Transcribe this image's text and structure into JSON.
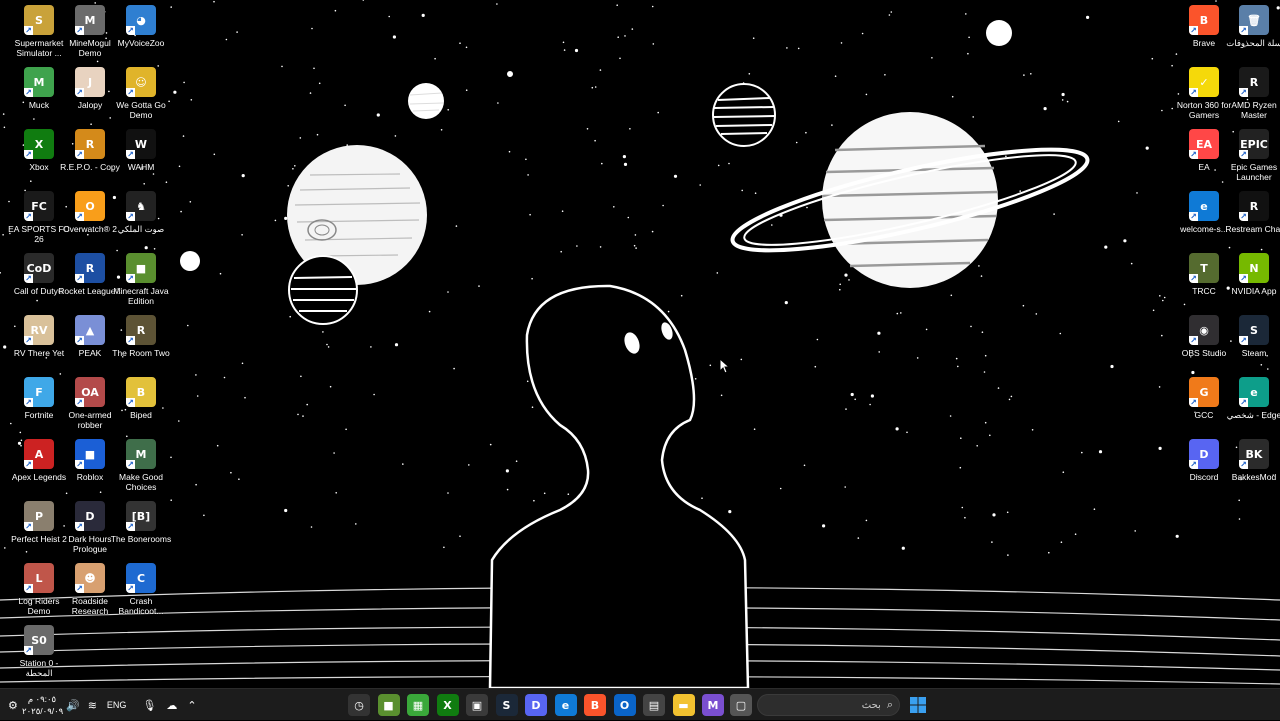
{
  "desktop": {
    "left_icons": [
      {
        "label": "Supermarket Simulator ...",
        "icon": "supermarket-icon",
        "color": "#c9a23a",
        "glyph": "S",
        "col": 0,
        "row": 0
      },
      {
        "label": "MineMogul Demo",
        "icon": "minemogul-icon",
        "color": "#6b6b6b",
        "glyph": "M",
        "col": 1,
        "row": 0
      },
      {
        "label": "MyVoiceZoo",
        "icon": "myvoicezoo-icon",
        "color": "#2f7fd1",
        "glyph": "◕",
        "col": 2,
        "row": 0
      },
      {
        "label": "Muck",
        "icon": "muck-icon",
        "color": "#3fa34d",
        "glyph": "M",
        "col": 0,
        "row": 1
      },
      {
        "label": "Jalopy",
        "icon": "jalopy-icon",
        "color": "#e8d3c0",
        "glyph": "J",
        "col": 1,
        "row": 1
      },
      {
        "label": "We Gotta Go Demo",
        "icon": "we-gotta-go-icon",
        "color": "#e0b42a",
        "glyph": "☺",
        "col": 2,
        "row": 1
      },
      {
        "label": "Xbox",
        "icon": "xbox-icon",
        "color": "#107c10",
        "glyph": "X",
        "col": 0,
        "row": 2
      },
      {
        "label": "R.E.P.O. - Copy",
        "icon": "repo-icon",
        "color": "#d48a1a",
        "glyph": "R",
        "col": 1,
        "row": 2
      },
      {
        "label": "WAHM",
        "icon": "wahm-icon",
        "color": "#111111",
        "glyph": "W",
        "col": 2,
        "row": 2
      },
      {
        "label": "EA SPORTS FC 26",
        "icon": "ea-fc-icon",
        "color": "#1a1a1a",
        "glyph": "FC",
        "col": 0,
        "row": 3
      },
      {
        "label": "Overwatch® 2",
        "icon": "overwatch-icon",
        "color": "#f99e1a",
        "glyph": "O",
        "col": 1,
        "row": 3
      },
      {
        "label": "صوت الملكي",
        "icon": "royal-voice-icon",
        "color": "#222222",
        "glyph": "♞",
        "col": 2,
        "row": 3
      },
      {
        "label": "Call of Duty®",
        "icon": "call-of-duty-icon",
        "color": "#2a2a2a",
        "glyph": "CoD",
        "col": 0,
        "row": 4
      },
      {
        "label": "Rocket League®",
        "icon": "rocket-league-icon",
        "color": "#1d4fa3",
        "glyph": "R",
        "col": 1,
        "row": 4
      },
      {
        "label": "Minecraft Java Edition",
        "icon": "minecraft-icon",
        "color": "#5a8f2f",
        "glyph": "■",
        "col": 2,
        "row": 4
      },
      {
        "label": "RV There Yet",
        "icon": "rv-there-yet-icon",
        "color": "#d9c19a",
        "glyph": "RV",
        "col": 0,
        "row": 5
      },
      {
        "label": "PEAK",
        "icon": "peak-icon",
        "color": "#7a8fd6",
        "glyph": "▲",
        "col": 1,
        "row": 5
      },
      {
        "label": "The Room Two",
        "icon": "the-room-two-icon",
        "color": "#5d5335",
        "glyph": "R",
        "col": 2,
        "row": 5
      },
      {
        "label": "Fortnite",
        "icon": "fortnite-icon",
        "color": "#3fa8e8",
        "glyph": "F",
        "col": 0,
        "row": 6
      },
      {
        "label": "One-armed robber",
        "icon": "one-armed-robber-icon",
        "color": "#b34a4a",
        "glyph": "OA",
        "col": 1,
        "row": 6
      },
      {
        "label": "Biped",
        "icon": "biped-icon",
        "color": "#e2c13a",
        "glyph": "B",
        "col": 2,
        "row": 6
      },
      {
        "label": "Apex Legends",
        "icon": "apex-legends-icon",
        "color": "#cc2222",
        "glyph": "A",
        "col": 0,
        "row": 7
      },
      {
        "label": "Roblox",
        "icon": "roblox-icon",
        "color": "#1b5fd6",
        "glyph": "■",
        "col": 1,
        "row": 7
      },
      {
        "label": "Make Good Choices",
        "icon": "make-good-choices-icon",
        "color": "#3f6e4a",
        "glyph": "M",
        "col": 2,
        "row": 7
      },
      {
        "label": "Perfect Heist 2",
        "icon": "perfect-heist-icon",
        "color": "#8a7f6e",
        "glyph": "P",
        "col": 0,
        "row": 8
      },
      {
        "label": "Dark Hours Prologue",
        "icon": "dark-hours-icon",
        "color": "#2a2a3a",
        "glyph": "D",
        "col": 1,
        "row": 8
      },
      {
        "label": "The Bonerooms",
        "icon": "bonerooms-icon",
        "color": "#333333",
        "glyph": "[B]",
        "col": 2,
        "row": 8
      },
      {
        "label": "Log Riders Demo",
        "icon": "log-riders-icon",
        "color": "#c0564a",
        "glyph": "L",
        "col": 0,
        "row": 9
      },
      {
        "label": "Roadside Research",
        "icon": "roadside-research-icon",
        "color": "#d8a070",
        "glyph": "☻",
        "col": 1,
        "row": 9
      },
      {
        "label": "Crash Bandicoot...",
        "icon": "crash-bandicoot-icon",
        "color": "#1e6ad1",
        "glyph": "C",
        "col": 2,
        "row": 9
      },
      {
        "label": "Station 0 - المحطة",
        "icon": "station-zero-icon",
        "color": "#6a6a6a",
        "glyph": "S0",
        "col": 0,
        "row": 10
      }
    ],
    "right_icons": [
      {
        "label": "Brave",
        "icon": "brave-icon",
        "color": "#fb542b",
        "glyph": "B",
        "col": 0,
        "row": 0
      },
      {
        "label": "سلة المحذوفات",
        "icon": "recycle-bin-icon",
        "color": "#5a7fa8",
        "glyph": "🗑",
        "col": 1,
        "row": 0
      },
      {
        "label": "Norton 360 for Gamers",
        "icon": "norton-icon",
        "color": "#f5d90a",
        "glyph": "✓",
        "col": 0,
        "row": 1
      },
      {
        "label": "AMD Ryzen Master",
        "icon": "amd-ryzen-icon",
        "color": "#1a1a1a",
        "glyph": "R",
        "col": 1,
        "row": 1
      },
      {
        "label": "EA",
        "icon": "ea-icon",
        "color": "#ff4747",
        "glyph": "EA",
        "col": 0,
        "row": 2
      },
      {
        "label": "Epic Games Launcher",
        "icon": "epic-games-icon",
        "color": "#222222",
        "glyph": "EPIC",
        "col": 1,
        "row": 2
      },
      {
        "label": "welcome-s...",
        "icon": "edge-doc-icon",
        "color": "#0f7ad6",
        "glyph": "e",
        "col": 0,
        "row": 3
      },
      {
        "label": "Restream Chat",
        "icon": "restream-icon",
        "color": "#111111",
        "glyph": "R",
        "col": 1,
        "row": 3
      },
      {
        "label": "TRCC",
        "icon": "trcc-icon",
        "color": "#556b2f",
        "glyph": "T",
        "col": 0,
        "row": 4
      },
      {
        "label": "NVIDIA App",
        "icon": "nvidia-icon",
        "color": "#76b900",
        "glyph": "N",
        "col": 1,
        "row": 4
      },
      {
        "label": "OBS Studio",
        "icon": "obs-icon",
        "color": "#302e31",
        "glyph": "◉",
        "col": 0,
        "row": 5
      },
      {
        "label": "Steam",
        "icon": "steam-icon",
        "color": "#1b2838",
        "glyph": "S",
        "col": 1,
        "row": 5
      },
      {
        "label": "GCC",
        "icon": "gcc-icon",
        "color": "#f07a1a",
        "glyph": "G",
        "col": 0,
        "row": 6
      },
      {
        "label": "شخصي - Edge",
        "icon": "edge-personal-icon",
        "color": "#0d9e8a",
        "glyph": "e",
        "col": 1,
        "row": 6
      },
      {
        "label": "Discord",
        "icon": "discord-icon",
        "color": "#5865f2",
        "glyph": "D",
        "col": 0,
        "row": 7
      },
      {
        "label": "BakkesMod",
        "icon": "bakkesmod-icon",
        "color": "#2b2b2b",
        "glyph": "BK",
        "col": 1,
        "row": 7
      }
    ]
  },
  "taskbar": {
    "clock_time": "٠٩:٠٥ م",
    "clock_date": "٢٠٢٥/٠٩/٠٩",
    "language": "ENG",
    "search_placeholder": "بحث",
    "apps": [
      {
        "name": "taskbar-clock-app-icon",
        "color": "#333333",
        "glyph": "◷"
      },
      {
        "name": "taskbar-minecraft-icon",
        "color": "#5a8f2f",
        "glyph": "■"
      },
      {
        "name": "taskbar-creeper-icon",
        "color": "#3aa83a",
        "glyph": "▦"
      },
      {
        "name": "taskbar-xbox-icon",
        "color": "#107c10",
        "glyph": "X"
      },
      {
        "name": "taskbar-app-icon",
        "color": "#3a3a3a",
        "glyph": "▣"
      },
      {
        "name": "taskbar-steam-icon",
        "color": "#1b2838",
        "glyph": "S"
      },
      {
        "name": "taskbar-discord-icon",
        "color": "#5865f2",
        "glyph": "D"
      },
      {
        "name": "taskbar-edge-icon",
        "color": "#0f7ad6",
        "glyph": "e"
      },
      {
        "name": "taskbar-brave-icon",
        "color": "#fb542b",
        "glyph": "B"
      },
      {
        "name": "taskbar-outlook-icon",
        "color": "#0a64c8",
        "glyph": "O"
      },
      {
        "name": "taskbar-store-icon",
        "color": "#444444",
        "glyph": "▤"
      },
      {
        "name": "taskbar-file-explorer-icon",
        "color": "#f2c230",
        "glyph": "▬"
      },
      {
        "name": "taskbar-m365-icon",
        "color": "#7a4fd0",
        "glyph": "M"
      },
      {
        "name": "taskbar-window-icon",
        "color": "#555555",
        "glyph": "▢"
      }
    ]
  }
}
